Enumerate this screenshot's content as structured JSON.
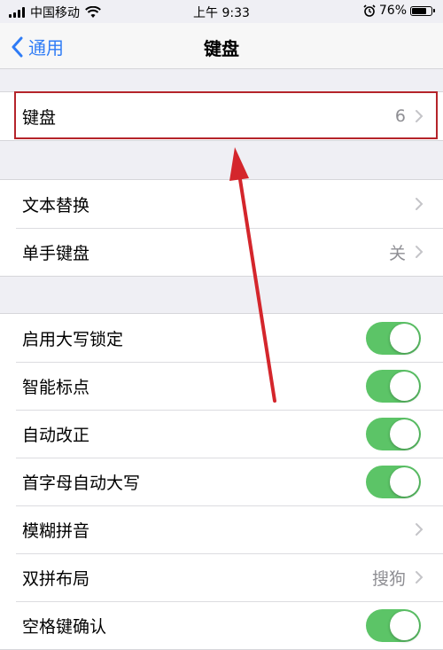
{
  "status_bar": {
    "carrier": "中国移动",
    "time": "上午 9:33",
    "battery": "76%",
    "icons": [
      "signal-icon",
      "wifi-icon",
      "alarm-icon",
      "battery-icon"
    ]
  },
  "nav": {
    "back_label": "通用",
    "title": "键盘"
  },
  "group1": {
    "keyboards": {
      "label": "键盘",
      "value": "6"
    }
  },
  "group2": {
    "text_replacement": {
      "label": "文本替换"
    },
    "one_handed": {
      "label": "单手键盘",
      "value": "关"
    }
  },
  "group3": {
    "caps_lock": {
      "label": "启用大写锁定",
      "on": true
    },
    "smart_punctuation": {
      "label": "智能标点",
      "on": true
    },
    "auto_correction": {
      "label": "自动改正",
      "on": true
    },
    "auto_capitalization": {
      "label": "首字母自动大写",
      "on": true
    },
    "fuzzy_pinyin": {
      "label": "模糊拼音"
    },
    "shuangpin_layout": {
      "label": "双拼布局",
      "value": "搜狗"
    },
    "space_confirm": {
      "label": "空格键确认",
      "on": true
    }
  },
  "colors": {
    "accent": "#2f7cf6",
    "toggle_on": "#5cc467",
    "highlight": "#b5242a",
    "arrow": "#d4262c",
    "background": "#efeff4"
  }
}
